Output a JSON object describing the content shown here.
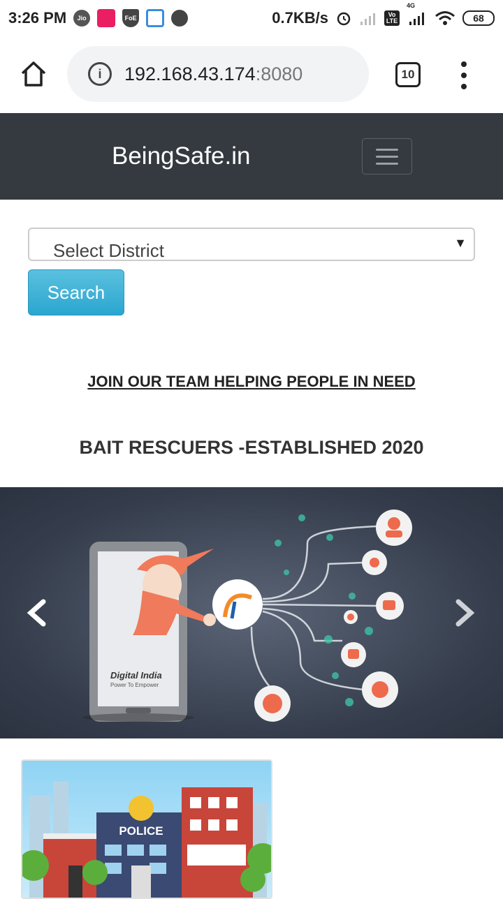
{
  "status_bar": {
    "time": "3:26 PM",
    "network_speed": "0.7KB/s",
    "battery": "68",
    "jio_label": "Jio",
    "foe_label": "FoE",
    "lte_label": "Vo LTE",
    "network_type": "4G"
  },
  "browser": {
    "url_host": "192.168.43.174",
    "url_port": ":8080",
    "tab_count": "10"
  },
  "navbar": {
    "brand": "BeingSafe.in"
  },
  "form": {
    "select_placeholder": "Select District",
    "search_label": "Search"
  },
  "content": {
    "join_link": "JOIN OUR TEAM HELPING PEOPLE IN NEED",
    "established_title": "BAIT RESCUERS -ESTABLISHED 2020"
  },
  "carousel": {
    "prev_glyph": "‹",
    "next_glyph": "›",
    "slide_caption": "Digital India",
    "slide_subcaption": "Power To Empower"
  },
  "police_card": {
    "sign": "POLICE"
  },
  "colors": {
    "navbar_bg": "#343a40",
    "search_btn": "#5bc0de",
    "carousel_bg": "#353d4c"
  }
}
